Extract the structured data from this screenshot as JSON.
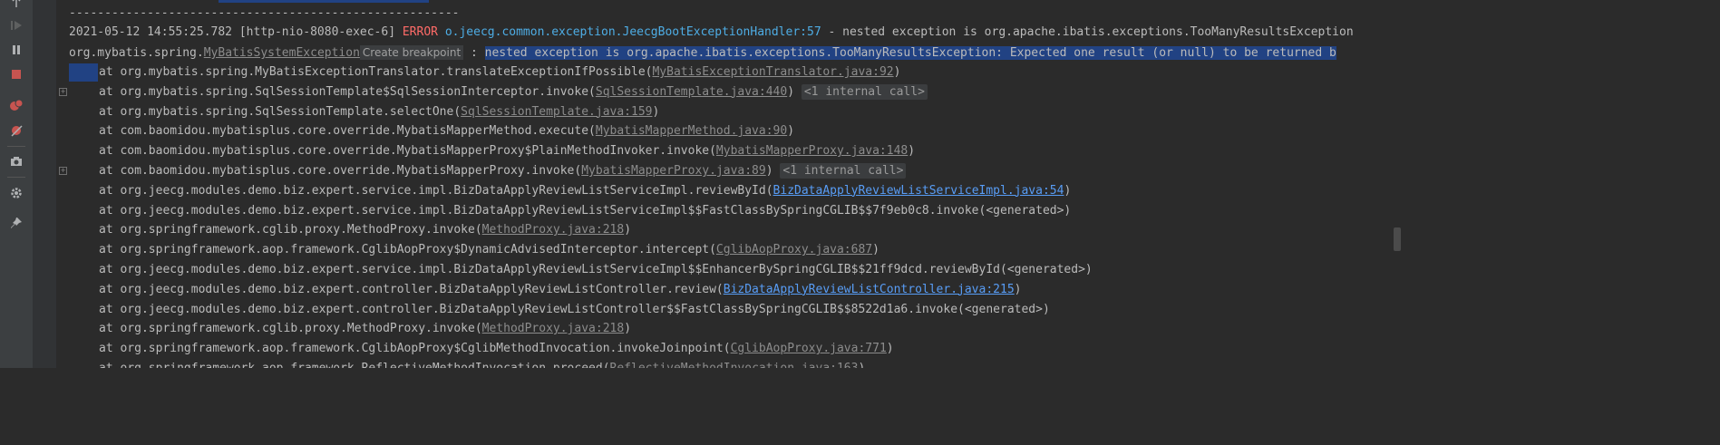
{
  "toolbar": {
    "icons": [
      "arrow-up-icon",
      "resume-icon",
      "arrow-down-icon",
      "pause-icon",
      "soft-wrap-icon",
      "stop-icon",
      "scroll-to-end-icon",
      "breakpoints-icon",
      "print-icon",
      "mute-breakpoints-icon",
      "clear-icon",
      "camera-icon",
      "settings-icon",
      "pin-icon"
    ]
  },
  "console": {
    "separator": "-------------------------------------------------------",
    "error_line": {
      "timestamp": "2021-05-12 14:55:25.782",
      "thread": "[http-nio-8080-exec-6]",
      "level": "ERROR",
      "logger": "o.jeecg.common.exception.JeecgBootExceptionHandler:57",
      "message": " - nested exception is org.apache.ibatis.exceptions.TooManyResultsException"
    },
    "exception_line": {
      "prefix": "org.mybatis.spring.",
      "class_link": "MyBatisSystemException",
      "tooltip": "Create breakpoint",
      "colon": " : ",
      "message": "nested exception is org.apache.ibatis.exceptions.TooManyResultsException: Expected one result (or null) to be returned b"
    },
    "frames": [
      {
        "text": "at org.mybatis.spring.MyBatisExceptionTranslator.translateExceptionIfPossible(",
        "link": "MyBatisExceptionTranslator.java:92",
        "end": ")",
        "badge": "",
        "blue": false
      },
      {
        "text": "at org.mybatis.spring.SqlSessionTemplate$SqlSessionInterceptor.invoke(",
        "link": "SqlSessionTemplate.java:440",
        "end": ")",
        "badge": "<1 internal call>",
        "blue": false
      },
      {
        "text": "at org.mybatis.spring.SqlSessionTemplate.selectOne(",
        "link": "SqlSessionTemplate.java:159",
        "end": ")",
        "badge": "",
        "blue": false
      },
      {
        "text": "at com.baomidou.mybatisplus.core.override.MybatisMapperMethod.execute(",
        "link": "MybatisMapperMethod.java:90",
        "end": ")",
        "badge": "",
        "blue": false
      },
      {
        "text": "at com.baomidou.mybatisplus.core.override.MybatisMapperProxy$PlainMethodInvoker.invoke(",
        "link": "MybatisMapperProxy.java:148",
        "end": ")",
        "badge": "",
        "blue": false
      },
      {
        "text": "at com.baomidou.mybatisplus.core.override.MybatisMapperProxy.invoke(",
        "link": "MybatisMapperProxy.java:89",
        "end": ")",
        "badge": "<1 internal call>",
        "blue": false
      },
      {
        "text": "at org.jeecg.modules.demo.biz.expert.service.impl.BizDataApplyReviewListServiceImpl.reviewById(",
        "link": "BizDataApplyReviewListServiceImpl.java:54",
        "end": ")",
        "badge": "",
        "blue": true
      },
      {
        "text": "at org.jeecg.modules.demo.biz.expert.service.impl.BizDataApplyReviewListServiceImpl$$FastClassBySpringCGLIB$$7f9eb0c8.invoke(<generated>)",
        "link": "",
        "end": "",
        "badge": "",
        "blue": false
      },
      {
        "text": "at org.springframework.cglib.proxy.MethodProxy.invoke(",
        "link": "MethodProxy.java:218",
        "end": ")",
        "badge": "",
        "blue": false
      },
      {
        "text": "at org.springframework.aop.framework.CglibAopProxy$DynamicAdvisedInterceptor.intercept(",
        "link": "CglibAopProxy.java:687",
        "end": ")",
        "badge": "",
        "blue": false
      },
      {
        "text": "at org.jeecg.modules.demo.biz.expert.service.impl.BizDataApplyReviewListServiceImpl$$EnhancerBySpringCGLIB$$21ff9dcd.reviewById(<generated>)",
        "link": "",
        "end": "",
        "badge": "",
        "blue": false
      },
      {
        "text": "at org.jeecg.modules.demo.biz.expert.controller.BizDataApplyReviewListController.review(",
        "link": "BizDataApplyReviewListController.java:215",
        "end": ")",
        "badge": "",
        "blue": true
      },
      {
        "text": "at org.jeecg.modules.demo.biz.expert.controller.BizDataApplyReviewListController$$FastClassBySpringCGLIB$$8522d1a6.invoke(<generated>)",
        "link": "",
        "end": "",
        "badge": "",
        "blue": false
      },
      {
        "text": "at org.springframework.cglib.proxy.MethodProxy.invoke(",
        "link": "MethodProxy.java:218",
        "end": ")",
        "badge": "",
        "blue": false
      },
      {
        "text": "at org.springframework.aop.framework.CglibAopProxy$CglibMethodInvocation.invokeJoinpoint(",
        "link": "CglibAopProxy.java:771",
        "end": ")",
        "badge": "",
        "blue": false
      },
      {
        "text": "at org.springframework.aop.framework.ReflectiveMethodInvocation.proceed(",
        "link": "ReflectiveMethodInvocation.java:163",
        "end": ")",
        "badge": "",
        "blue": false
      }
    ]
  }
}
